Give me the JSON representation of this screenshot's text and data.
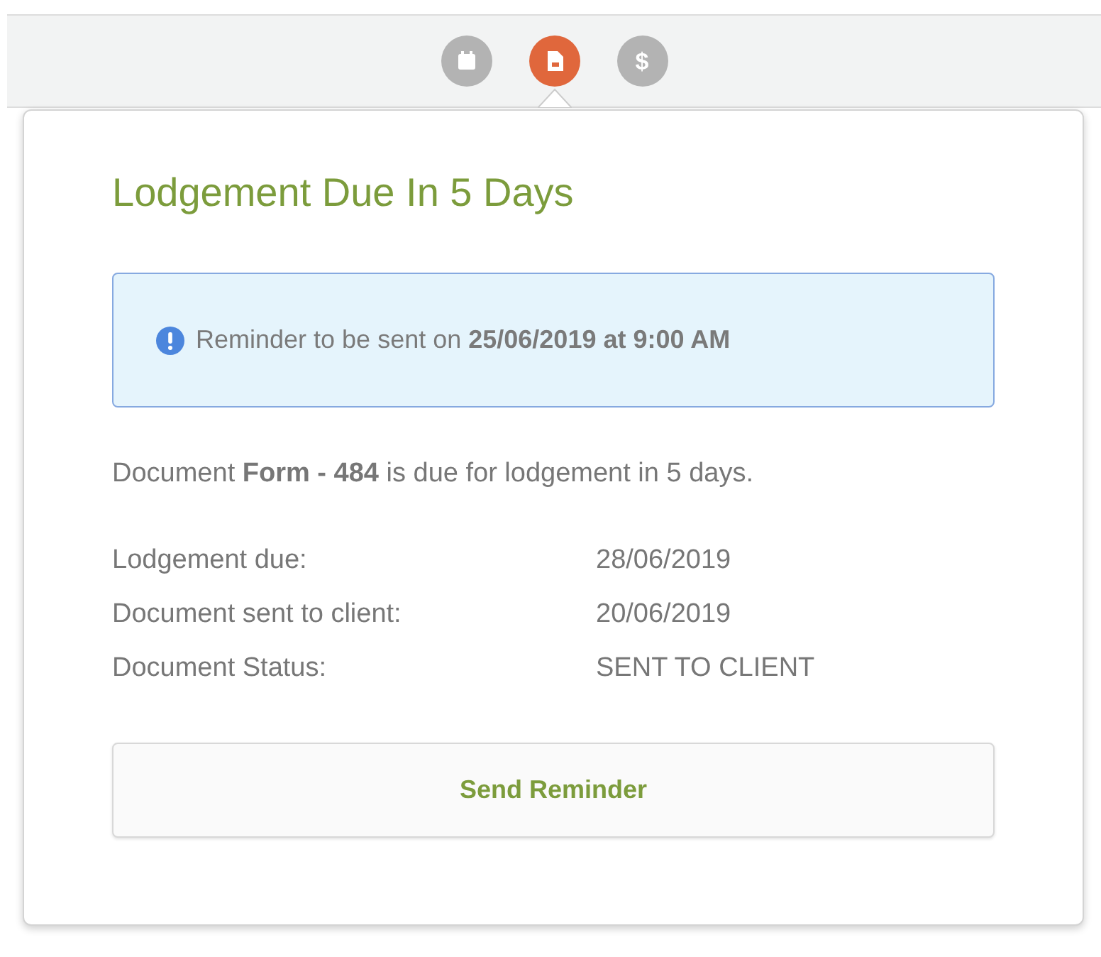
{
  "toolbar": {
    "tabs": [
      {
        "kind": "calendar",
        "selected": false
      },
      {
        "kind": "document",
        "selected": true
      },
      {
        "kind": "glyph",
        "glyph": "$",
        "selected": false
      }
    ]
  },
  "popover": {
    "title": "Lodgement Due In 5 Days",
    "notice": "Reminder to be sent on **25/06/2019 at 9:00 AM**",
    "message": "Document **Form - 484** is due for lodgement in 5 days.",
    "details": [
      {
        "label": "Lodgement due:",
        "value": "28/06/2019"
      },
      {
        "label": "Document sent to client:",
        "value": "20/06/2019"
      },
      {
        "label": "Document Status:",
        "value": "SENT TO CLIENT"
      }
    ],
    "button": "Send Reminder"
  }
}
